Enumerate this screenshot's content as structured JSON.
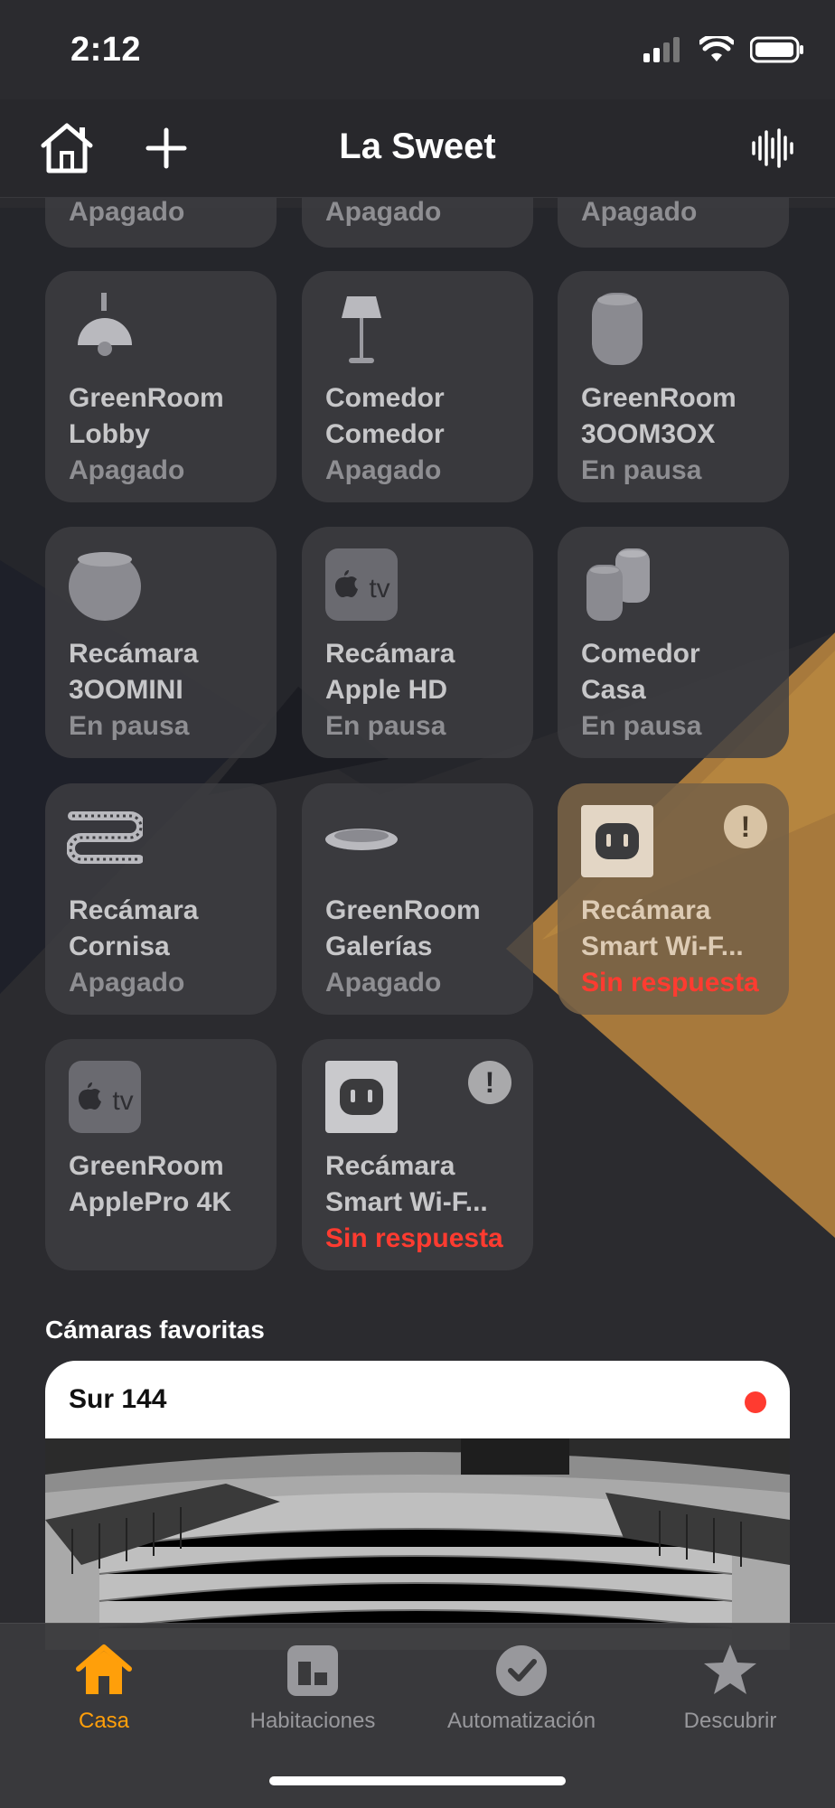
{
  "status": {
    "time": "2:12"
  },
  "header": {
    "title": "La Sweet"
  },
  "colors": {
    "accent": "#ff9f0a",
    "alert": "#ff3b30",
    "tile": "#3e3e42"
  },
  "partial_row": [
    {
      "state": "Apagado"
    },
    {
      "state": "Apagado"
    },
    {
      "state": "Apagado"
    }
  ],
  "tiles": [
    {
      "room": "GreenRoom",
      "name": "Lobby",
      "state": "Apagado",
      "icon": "pendant-lamp-icon"
    },
    {
      "room": "Comedor",
      "name": "Comedor",
      "state": "Apagado",
      "icon": "floor-lamp-icon"
    },
    {
      "room": "GreenRoom",
      "name": "3OOM3OX",
      "state": "En pausa",
      "icon": "homepod-icon"
    },
    {
      "room": "Recámara",
      "name": "3OOMINI",
      "state": "En pausa",
      "icon": "homepod-mini-icon"
    },
    {
      "room": "Recámara",
      "name": "Apple HD",
      "state": "En pausa",
      "icon": "appletv-icon",
      "tv_label": "tv"
    },
    {
      "room": "Comedor",
      "name": "Casa",
      "state": "En pausa",
      "icon": "speaker-group-icon"
    },
    {
      "room": "Recámara",
      "name": "Cornisa",
      "state": "Apagado",
      "icon": "lightstrip-icon"
    },
    {
      "room": "GreenRoom",
      "name": "Galerías",
      "state": "Apagado",
      "icon": "ceiling-light-icon"
    },
    {
      "room": "Recámara",
      "name": "Smart Wi-F...",
      "state": "Sin respuesta",
      "icon": "outlet-icon",
      "alert": true
    },
    {
      "room": "GreenRoom",
      "name": "ApplePro 4K",
      "state": "",
      "icon": "appletv-icon",
      "tv_label": "tv"
    },
    {
      "room": "Recámara",
      "name": "Smart Wi-F...",
      "state": "Sin respuesta",
      "icon": "outlet-icon",
      "alert": true
    }
  ],
  "alert_badge": "!",
  "cameras": {
    "section_title": "Cámaras favoritas",
    "items": [
      {
        "name": "Sur 144"
      }
    ]
  },
  "tabbar": [
    {
      "label": "Casa",
      "icon": "house-icon",
      "active": true
    },
    {
      "label": "Habitaciones",
      "icon": "rooms-icon",
      "active": false
    },
    {
      "label": "Automatización",
      "icon": "clock-check-icon",
      "active": false
    },
    {
      "label": "Descubrir",
      "icon": "star-icon",
      "active": false
    }
  ]
}
